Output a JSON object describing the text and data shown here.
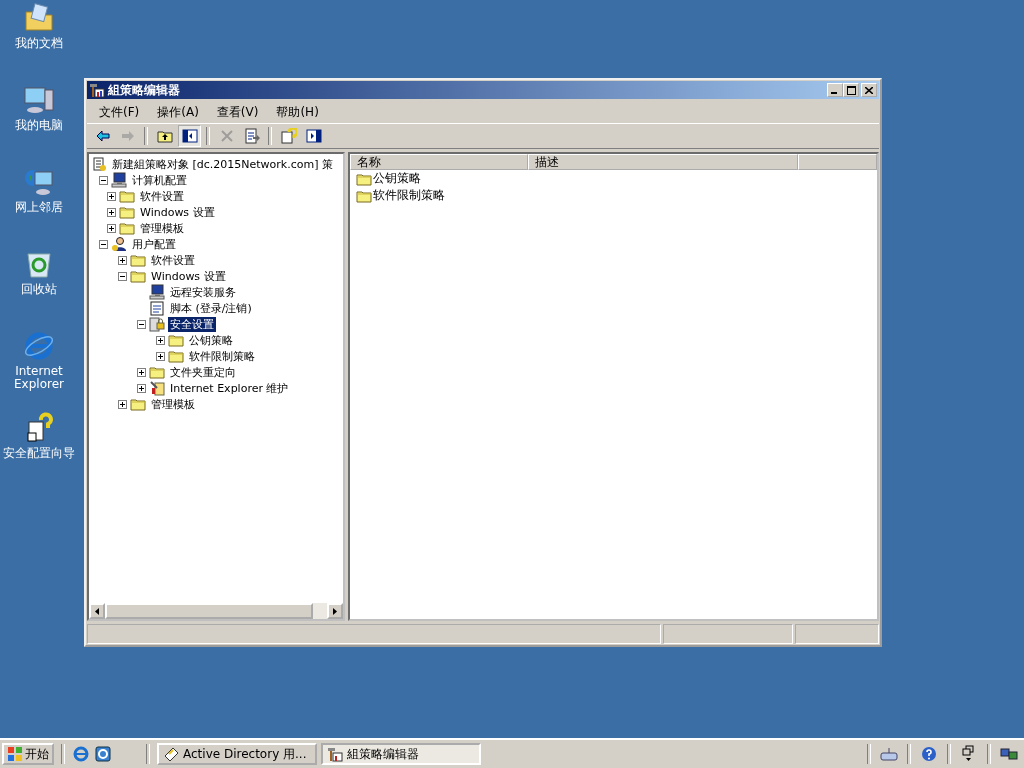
{
  "desktop_icons": [
    {
      "kind": "documents",
      "label": "我的文档"
    },
    {
      "kind": "computer",
      "label": "我的电脑"
    },
    {
      "kind": "network",
      "label": "网上邻居"
    },
    {
      "kind": "recycle",
      "label": "回收站"
    },
    {
      "kind": "ie",
      "label": "Internet Explorer"
    },
    {
      "kind": "wizard",
      "label": "安全配置向导"
    }
  ],
  "window": {
    "title": "組策略编辑器"
  },
  "menu": [
    {
      "label": "文件(F)"
    },
    {
      "label": "操作(A)"
    },
    {
      "label": "查看(V)"
    },
    {
      "label": "帮助(H)"
    }
  ],
  "toolbar": [
    {
      "kind": "back",
      "disabled": false,
      "selected": false
    },
    {
      "kind": "forward",
      "disabled": true,
      "selected": false
    },
    {
      "kind": "up",
      "disabled": false,
      "selected": false
    },
    {
      "kind": "tree",
      "disabled": false,
      "selected": true
    },
    {
      "kind": "delete",
      "disabled": true,
      "selected": false
    },
    {
      "kind": "export",
      "disabled": false,
      "selected": false
    },
    {
      "kind": "help",
      "disabled": false,
      "selected": false
    },
    {
      "kind": "pane",
      "disabled": false,
      "selected": false
    }
  ],
  "tree": [
    {
      "kind": "root",
      "label": "新建組策略对象 [dc.2015Network.com] 策",
      "selected": false,
      "children": [
        {
          "kind": "computer",
          "label": "计算机配置",
          "selected": false,
          "expanded": true,
          "children": [
            {
              "kind": "folder",
              "label": "软件设置",
              "selected": false,
              "expanded": false
            },
            {
              "kind": "folder",
              "label": "Windows 设置",
              "selected": false,
              "expanded": false
            },
            {
              "kind": "folder",
              "label": "管理模板",
              "selected": false,
              "expanded": false
            }
          ]
        },
        {
          "kind": "user",
          "label": "用户配置",
          "selected": false,
          "expanded": true,
          "children": [
            {
              "kind": "folder",
              "label": "软件设置",
              "selected": false,
              "expanded": false
            },
            {
              "kind": "folder",
              "label": "Windows 设置",
              "selected": false,
              "expanded": true,
              "children": [
                {
                  "kind": "remote",
                  "label": "远程安装服务",
                  "selected": false
                },
                {
                  "kind": "script",
                  "label": "脚本 (登录/注销)",
                  "selected": false
                },
                {
                  "kind": "security",
                  "label": "安全设置",
                  "selected": true,
                  "expanded": true,
                  "children": [
                    {
                      "kind": "folder",
                      "label": "公钥策略",
                      "selected": false,
                      "expanded": false
                    },
                    {
                      "kind": "folder",
                      "label": "软件限制策略",
                      "selected": false,
                      "expanded": false
                    }
                  ]
                },
                {
                  "kind": "folder",
                  "label": "文件夹重定向",
                  "selected": false,
                  "expanded": false
                },
                {
                  "kind": "ie",
                  "label": "Internet Explorer 维护",
                  "selected": false,
                  "expanded": false
                }
              ]
            },
            {
              "kind": "folder",
              "label": "管理模板",
              "selected": false,
              "expanded": false
            }
          ]
        }
      ]
    }
  ],
  "list": {
    "columns": [
      "名称",
      "描述"
    ],
    "rows": [
      {
        "name": "公钥策略"
      },
      {
        "name": "软件限制策略"
      }
    ]
  },
  "taskbar": {
    "start": "开始",
    "quick_launch": [
      {
        "kind": "ie"
      },
      {
        "kind": "desktop"
      }
    ],
    "tasks": [
      {
        "kind": "ad",
        "label": "Active Directory 用...",
        "selected": false
      },
      {
        "kind": "gpedit",
        "label": "組策略编辑器",
        "selected": true
      }
    ],
    "tray": [
      {
        "kind": "keyboard"
      },
      {
        "kind": "help"
      },
      {
        "kind": "restore"
      },
      {
        "kind": "network"
      }
    ]
  }
}
